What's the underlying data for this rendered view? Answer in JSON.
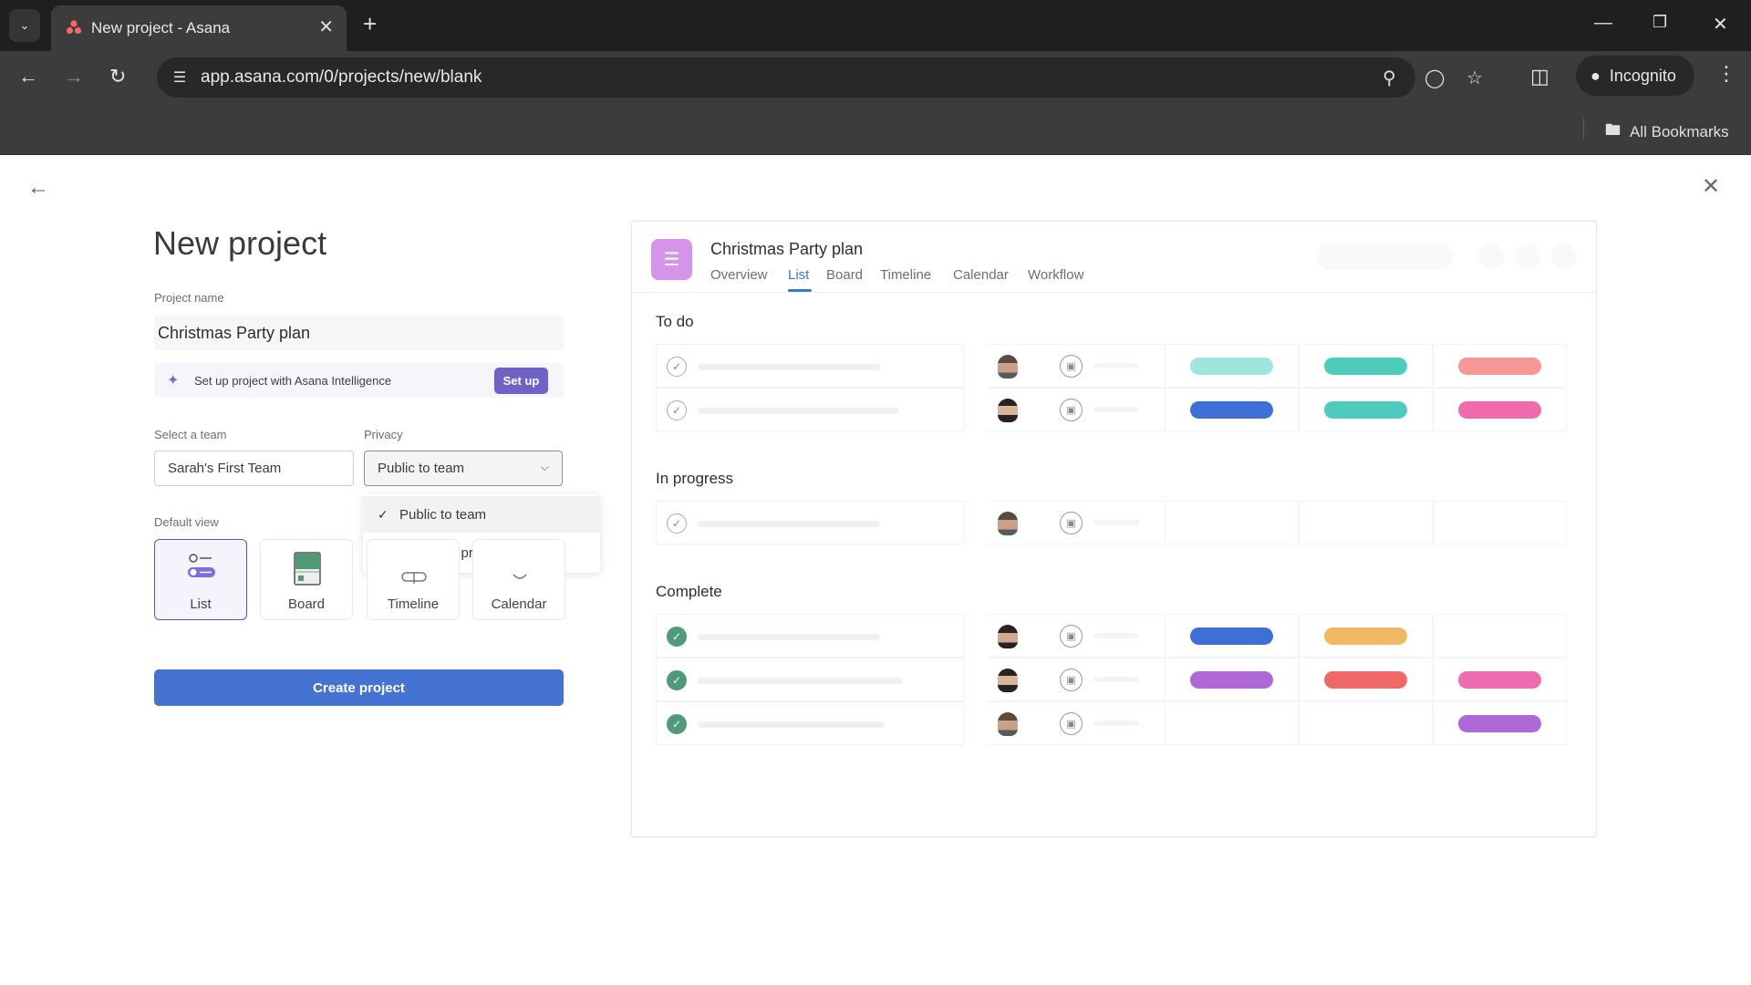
{
  "browser": {
    "tab_title": "New project - Asana",
    "url": "app.asana.com/0/projects/new/blank",
    "incognito_label": "Incognito",
    "bookmarks_label": "All Bookmarks"
  },
  "page": {
    "title": "New project",
    "project_name_label": "Project name",
    "project_name_value": "Christmas Party plan",
    "ai_banner_text": "Set up project with Asana Intelligence",
    "ai_setup_button": "Set up",
    "team_label": "Select a team",
    "team_value": "Sarah's First Team",
    "privacy_label": "Privacy",
    "privacy_value": "Public to team",
    "privacy_options": [
      {
        "label": "Public to team",
        "selected": true
      },
      {
        "label": "Private to project members",
        "selected": false
      }
    ],
    "default_view_label": "Default view",
    "views": [
      {
        "label": "List",
        "selected": true
      },
      {
        "label": "Board",
        "selected": false
      },
      {
        "label": "Timeline",
        "selected": false
      },
      {
        "label": "Calendar",
        "selected": false
      }
    ],
    "create_button": "Create project"
  },
  "preview": {
    "project_title": "Christmas Party plan",
    "tabs": [
      "Overview",
      "List",
      "Board",
      "Timeline",
      "Calendar",
      "Workflow"
    ],
    "active_tab": "List",
    "sections": [
      {
        "title": "To do",
        "rows": [
          {
            "done": false,
            "avatar": "man",
            "pills": [
              "#9ee5dd",
              "#4fcbbe",
              "#f59797"
            ]
          },
          {
            "done": false,
            "avatar": "woman",
            "pills": [
              "#3e6fd4",
              "#4fcbbe",
              "#f06ab0"
            ]
          }
        ]
      },
      {
        "title": "In progress",
        "rows": [
          {
            "done": false,
            "avatar": "man",
            "pills": [
              null,
              null,
              null
            ]
          }
        ]
      },
      {
        "title": "Complete",
        "rows": [
          {
            "done": true,
            "avatar": "man2",
            "pills": [
              "#3e6fd4",
              "#f2b866",
              null
            ]
          },
          {
            "done": true,
            "avatar": "woman",
            "pills": [
              "#b068d8",
              "#ee6868",
              "#f06ab0"
            ]
          },
          {
            "done": true,
            "avatar": "man",
            "pills": [
              null,
              null,
              "#b068d8"
            ]
          }
        ]
      }
    ]
  },
  "colors": {
    "accent": "#4573d2",
    "ai_purple": "#6e62c4",
    "project_icon": "#d494e8",
    "done_green": "#4f9b78"
  }
}
